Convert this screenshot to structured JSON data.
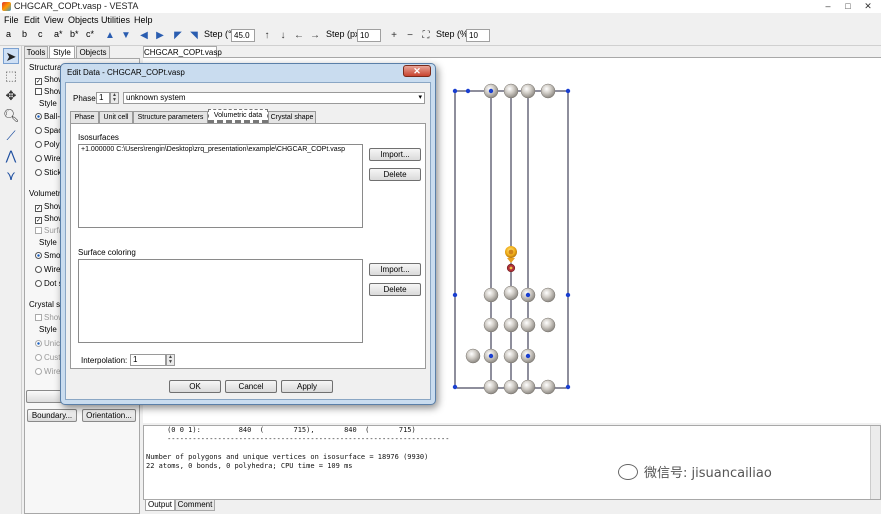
{
  "window": {
    "title": "CHGCAR_COPt.vasp - VESTA",
    "minimize": "–",
    "maximize": "□",
    "close": "✕"
  },
  "menu": [
    "File",
    "Edit",
    "View",
    "Objects",
    "Utilities",
    "Help"
  ],
  "toolbar": {
    "axis_buttons": [
      "a",
      "b",
      "c",
      "a*",
      "b*",
      "c*"
    ],
    "rotate_step_label": "Step (°):",
    "rotate_step_value": "45.0",
    "translate_step_label": "Step (px):",
    "translate_step_value": "10",
    "zoom_step_label": "Step (%):",
    "zoom_step_value": "10"
  },
  "left_panel": {
    "tabs": [
      "Tools",
      "Style",
      "Objects"
    ],
    "structural_heading": "Structural",
    "structural_items": [
      "Show",
      "Show"
    ],
    "style_label": "Style",
    "style_options": [
      "Ball-",
      "Spac",
      "Poly",
      "Wire",
      "Stick"
    ],
    "volumetric_heading": "Volumetric",
    "volumetric_items": [
      "Show",
      "Show",
      "Surfa"
    ],
    "volumetric_style_label": "Style",
    "volumetric_style_options": [
      "Smo",
      "Wire",
      "Dot s"
    ],
    "crystal_heading": "Crystal sh",
    "crystal_items": [
      "Show"
    ],
    "crystal_style_label": "Style",
    "crystal_style_options": [
      "Unic",
      "Cust",
      "Wire"
    ],
    "boundary_button": "Boundary...",
    "orientation_button": "Orientation..."
  },
  "document_tab": "CHGCAR_COPt.vasp",
  "dialog": {
    "title": "Edit Data - CHGCAR_COPt.vasp",
    "close": "✕",
    "phase_label": "Phase:",
    "phase_value": "1",
    "system_name": "unknown system",
    "tabs": [
      "Phase",
      "Unit cell",
      "Structure parameters",
      "Volumetric data",
      "Crystal shape"
    ],
    "isosurfaces_label": "Isosurfaces",
    "isosurface_entry": "+1.000000 C:\\Users\\rengin\\Desktop\\zrq_presentation\\example\\CHGCAR_COPt.vasp",
    "import_button": "Import...",
    "delete_button": "Delete",
    "surface_coloring_label": "Surface coloring",
    "import2_button": "Import...",
    "delete2_button": "Delete",
    "interpolation_label": "Interpolation:",
    "interpolation_value": "1",
    "ok_button": "OK",
    "cancel_button": "Cancel",
    "apply_button": "Apply"
  },
  "console": {
    "lines": [
      "     (0 0 1):         840  (       715),       840  (       715)",
      "     -------------------------------------------------------------------",
      "",
      "Number of polygons and unique vertices on isosurface = 18976 (9930)",
      "22 atoms, 0 bonds, 0 polyhedra; CPU time = 109 ms"
    ],
    "tabs": [
      "Output",
      "Comment"
    ]
  },
  "watermark": "微信号: jisuancailiao",
  "colors": {
    "atom_grey": "#c8c4be",
    "atom_blue": "#1a3fd0",
    "isosurface": "#f2b01a",
    "cell_line": "#1c1c3a",
    "dialog_frame": "#c9dcef"
  }
}
